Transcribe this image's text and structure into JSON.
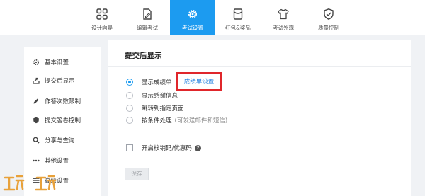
{
  "nav": {
    "tabs": [
      {
        "label": "设计向导",
        "icon": "grid-icon"
      },
      {
        "label": "编辑考试",
        "icon": "edit-document-icon"
      },
      {
        "label": "考试设置",
        "icon": "gear-icon",
        "active": true
      },
      {
        "label": "红包&奖品",
        "icon": "red-envelope-icon"
      },
      {
        "label": "考试外观",
        "icon": "tshirt-icon"
      },
      {
        "label": "质量控制",
        "icon": "shield-check-icon"
      }
    ]
  },
  "sidebar": {
    "items": [
      {
        "label": "基本设置",
        "icon": "gear-icon"
      },
      {
        "label": "提交后显示",
        "icon": "export-icon"
      },
      {
        "label": "作答次数限制",
        "icon": "pencil-icon"
      },
      {
        "label": "提交答卷控制",
        "icon": "shield-icon"
      },
      {
        "label": "分享与查询",
        "icon": "search-icon"
      },
      {
        "label": "其他设置",
        "icon": "more-icon"
      },
      {
        "label": "高级设置",
        "icon": "menu-icon"
      }
    ]
  },
  "main": {
    "title": "提交后显示",
    "options": [
      {
        "label": "显示成绩单",
        "checked": true
      },
      {
        "label": "显示感谢信息",
        "checked": false
      },
      {
        "label": "跳转到指定页面",
        "checked": false
      },
      {
        "label": "按条件处理",
        "note": "(可发送邮件和短信)",
        "checked": false
      }
    ],
    "setting_link": "成绩单设置",
    "coupon_label": "开启核销码/优惠码",
    "coupon_help": "?",
    "save_label": "保存"
  },
  "colors": {
    "accent": "#1c9bf0",
    "link": "#1c7ee0",
    "highlight": "#e0262b",
    "watermark": "#e8a13a"
  }
}
